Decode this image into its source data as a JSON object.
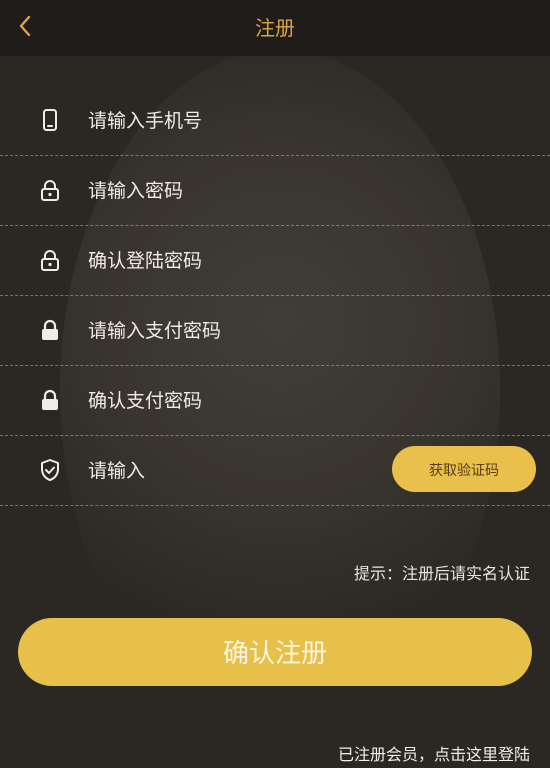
{
  "header": {
    "title": "注册",
    "back_icon": "chevron-left-icon"
  },
  "colors": {
    "accent": "#e6c048",
    "title": "#d8a546",
    "background": "#2b2824"
  },
  "form": {
    "fields": [
      {
        "label": "请输入手机号",
        "icon": "phone-icon"
      },
      {
        "label": "请输入密码",
        "icon": "lock-outline-icon"
      },
      {
        "label": "确认登陆密码",
        "icon": "lock-outline-icon"
      },
      {
        "label": "请输入支付密码",
        "icon": "lock-filled-icon"
      },
      {
        "label": "确认支付密码",
        "icon": "lock-filled-icon"
      },
      {
        "label": "请输入",
        "icon": "shield-check-icon"
      }
    ],
    "get_code_label": "获取验证码"
  },
  "hint": "提示：注册后请实名认证",
  "submit_label": "确认注册",
  "login_link": "已注册会员，点击这里登陆"
}
